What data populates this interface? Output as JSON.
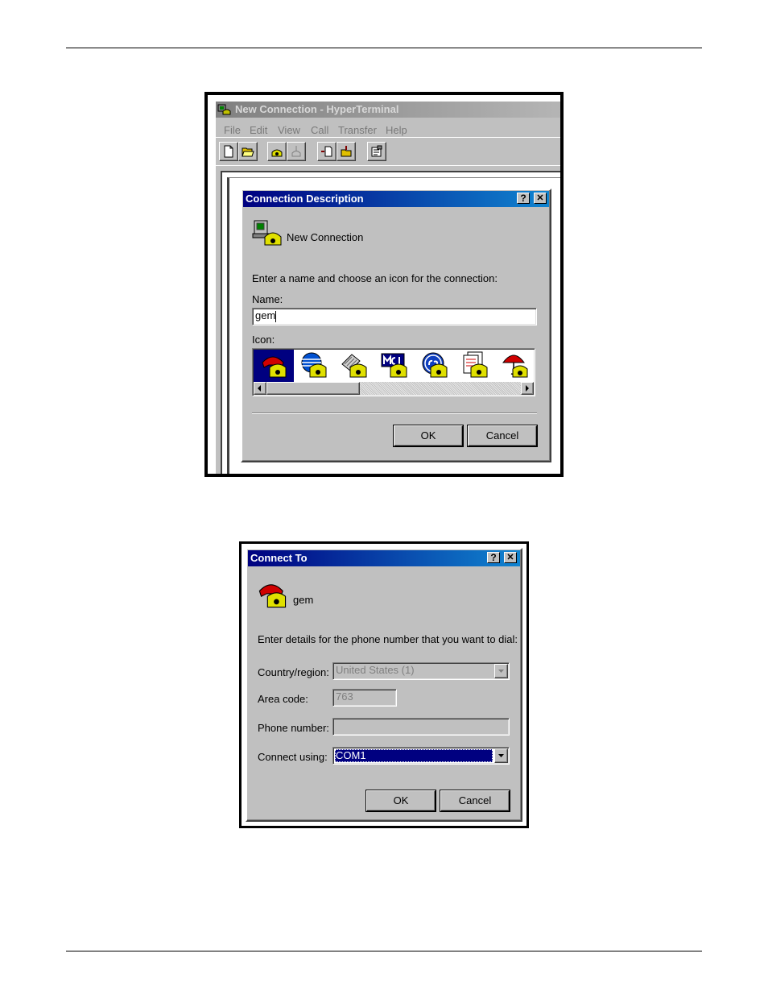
{
  "hyperterminal": {
    "title": "New Connection - HyperTerminal",
    "menu": [
      "File",
      "Edit",
      "View",
      "Call",
      "Transfer",
      "Help"
    ]
  },
  "connection_description": {
    "title": "Connection Description",
    "help_button": "?",
    "close_button": "✕",
    "connection_name_label": "New Connection",
    "instruction": "Enter a name and choose an icon for the connection:",
    "name_label": "Name:",
    "name_value": "gem",
    "icon_label": "Icon:",
    "icons": [
      "red-phone-icon",
      "globe-phone-icon",
      "fax-phone-icon",
      "mci-phone-icon",
      "ge-phone-icon",
      "documents-phone-icon",
      "umbrella-phone-icon"
    ],
    "ok_label": "OK",
    "cancel_label": "Cancel"
  },
  "connect_to": {
    "title": "Connect To",
    "help_button": "?",
    "close_button": "✕",
    "connection_name": "gem",
    "instruction": "Enter details for the phone number that you want to dial:",
    "country_label": "Country/region:",
    "country_value": "United States (1)",
    "area_code_label": "Area code:",
    "area_code_value": "763",
    "phone_label": "Phone number:",
    "phone_value": "",
    "connect_using_label": "Connect using:",
    "connect_using_value": "COM1",
    "ok_label": "OK",
    "cancel_label": "Cancel"
  },
  "colors": {
    "title_start": "#000080",
    "title_end": "#1084d0",
    "face": "#c0c0c0",
    "selection": "#000080"
  }
}
